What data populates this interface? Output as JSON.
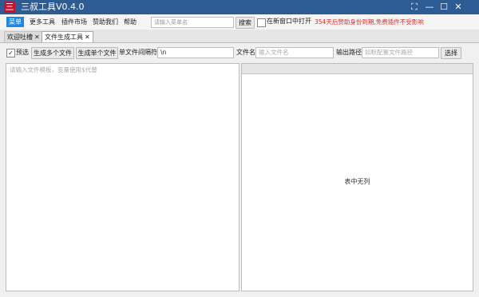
{
  "window": {
    "logo_text": "三",
    "title": "三叔工具V0.4.0",
    "controls": [
      "⛶",
      "—",
      "☐",
      "✕"
    ]
  },
  "menu": {
    "items": [
      "菜单",
      "更多工具",
      "插件市场",
      "赞助我们",
      "帮助"
    ],
    "search_placeholder": "请输入菜单名",
    "search_button": "搜索",
    "open_new_window_label": "在新窗口中打开",
    "notice": "354天后赞助身份到期,免费插件不受影响"
  },
  "tabs": [
    {
      "label": "欢迎吐槽",
      "close": "✕"
    },
    {
      "label": "文件生成工具",
      "close": "✕"
    }
  ],
  "toolbar": {
    "preview_label": "预选",
    "preview_checked": "✓",
    "gen_multi_label": "生成多个文件",
    "gen_single_label": "生成单个文件",
    "separator_label": "单文件间隔符",
    "separator_value": "\\n",
    "filename_label": "文件名",
    "filename_placeholder": "输入文件名",
    "output_label": "输出路径",
    "output_placeholder": "如默配置文件路径",
    "choose_label": "选择"
  },
  "editor": {
    "placeholder": "请输入文件模板，变量使用$代替"
  },
  "table": {
    "empty_text": "表中无列"
  }
}
